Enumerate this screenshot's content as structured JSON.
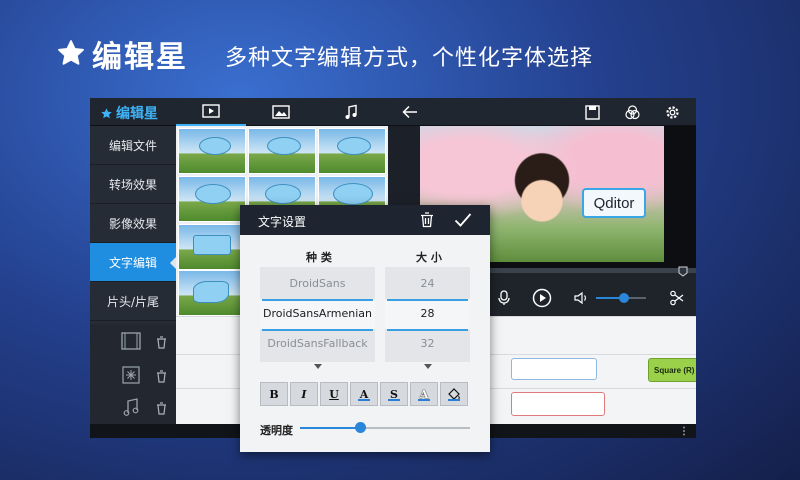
{
  "banner": {
    "app_name": "编辑星",
    "slogan": "多种文字编辑方式，个性化字体选择"
  },
  "appbar": {
    "logo_text": "编辑星",
    "tabs": [
      "play-tab",
      "image-tab",
      "music-tab"
    ],
    "icons": [
      "back-arrow-icon",
      "save-icon",
      "color-filter-icon",
      "settings-icon"
    ]
  },
  "sidebar": {
    "items": [
      {
        "label": "编辑文件"
      },
      {
        "label": "转场效果"
      },
      {
        "label": "影像效果"
      },
      {
        "label": "文字编辑",
        "active": true
      },
      {
        "label": "片头/片尾"
      }
    ]
  },
  "preview": {
    "bubble_text": "Qditor"
  },
  "timeline": {
    "clip_label": "Square (R)"
  },
  "dialog": {
    "title": "文字设置",
    "font_column": "种 类",
    "size_column": "大 小",
    "fonts": [
      "DroidSans",
      "DroidSansArmenian",
      "DroidSansFallback"
    ],
    "sizes": [
      "24",
      "28",
      "32"
    ],
    "selected_font": "DroidSansArmenian",
    "selected_size": "28",
    "format_buttons": [
      "B",
      "I",
      "U",
      "A",
      "S",
      "A",
      "fill"
    ],
    "opacity_label": "透明度",
    "opacity_value": 0.35
  },
  "playback": {
    "volume_level": 0.55
  },
  "colors": {
    "accent": "#1f8ee0",
    "clip_green": "#9ad04a"
  }
}
